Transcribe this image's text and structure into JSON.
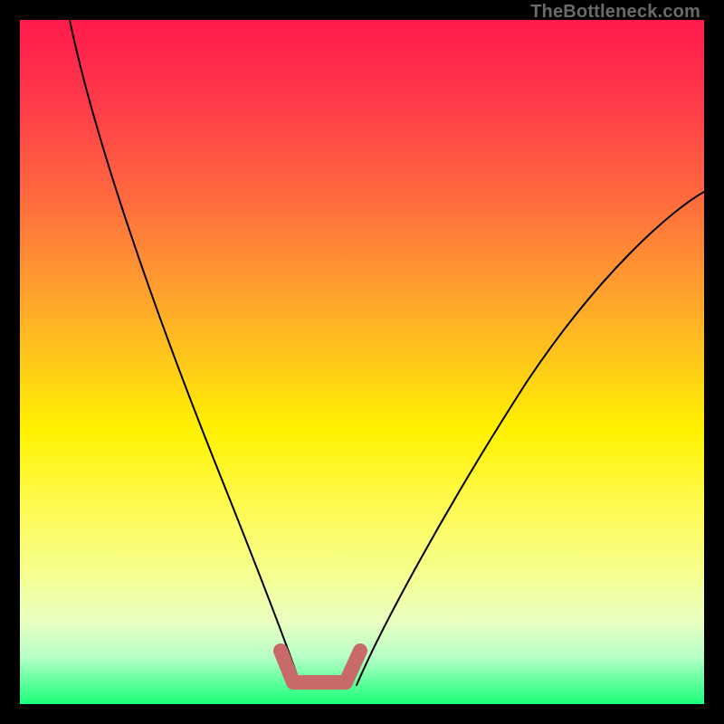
{
  "watermark": "TheBottleneck.com",
  "chart_data": {
    "type": "line",
    "title": "",
    "xlabel": "",
    "ylabel": "",
    "xlim": [
      0,
      100
    ],
    "ylim": [
      0,
      100
    ],
    "grid": false,
    "background_gradient": {
      "top": "#ff1a4d",
      "mid": "#fff200",
      "bottom": "#1aff7a"
    },
    "series": [
      {
        "name": "left-curve",
        "x": [
          0,
          10,
          20,
          30,
          35,
          38,
          40,
          42
        ],
        "values": [
          100,
          80,
          55,
          28,
          12,
          5,
          2,
          0
        ]
      },
      {
        "name": "right-curve",
        "x": [
          48,
          52,
          58,
          66,
          76,
          88,
          100
        ],
        "values": [
          0,
          6,
          16,
          30,
          45,
          58,
          68
        ]
      },
      {
        "name": "bottom-highlight",
        "x": [
          37,
          39,
          46,
          48
        ],
        "values": [
          5,
          0,
          0,
          5
        ]
      }
    ],
    "colors": {
      "left-curve": "#000000",
      "right-curve": "#000000",
      "bottom-highlight": "#c86a6a"
    }
  }
}
